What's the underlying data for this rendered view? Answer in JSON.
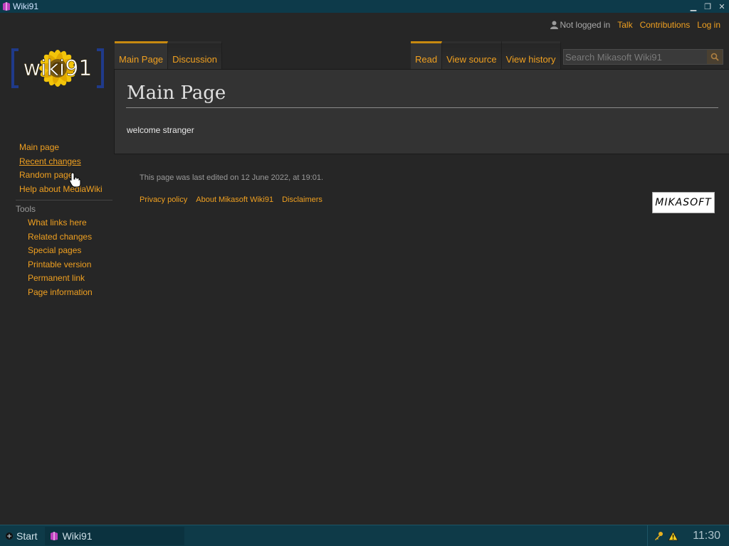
{
  "window": {
    "title": "Wiki91"
  },
  "personal": {
    "not_logged_in": "Not logged in",
    "talk": "Talk",
    "contributions": "Contributions",
    "log_in": "Log in"
  },
  "logo": {
    "text": "wiki91"
  },
  "tabs": {
    "main_page": "Main Page",
    "discussion": "Discussion",
    "read": "Read",
    "view_source": "View source",
    "view_history": "View history"
  },
  "search": {
    "placeholder": "Search Mikasoft Wiki91"
  },
  "content": {
    "title": "Main Page",
    "body": "welcome stranger"
  },
  "sidebar": {
    "nav": [
      "Main page",
      "Recent changes",
      "Random page",
      "Help about MediaWiki"
    ],
    "tools_heading": "Tools",
    "tools": [
      "What links here",
      "Related changes",
      "Special pages",
      "Printable version",
      "Permanent link",
      "Page information"
    ]
  },
  "footer": {
    "last_edited": "This page was last edited on 12 June 2022, at 19:01.",
    "links": [
      "Privacy policy",
      "About Mikasoft Wiki91",
      "Disclaimers"
    ],
    "badge": "MIKASOFT"
  },
  "taskbar": {
    "start": "Start",
    "task": "Wiki91",
    "clock": "11:30"
  },
  "colors": {
    "link": "#f0a020",
    "background": "#262626",
    "content_bg": "#333333",
    "taskbar": "#0e3a48"
  },
  "icons": [
    "wiki-book-icon",
    "minimize-icon",
    "restore-icon",
    "close-icon",
    "user-icon",
    "search-icon",
    "hand-cursor-icon",
    "start-icon",
    "key-icon",
    "warning-icon"
  ]
}
